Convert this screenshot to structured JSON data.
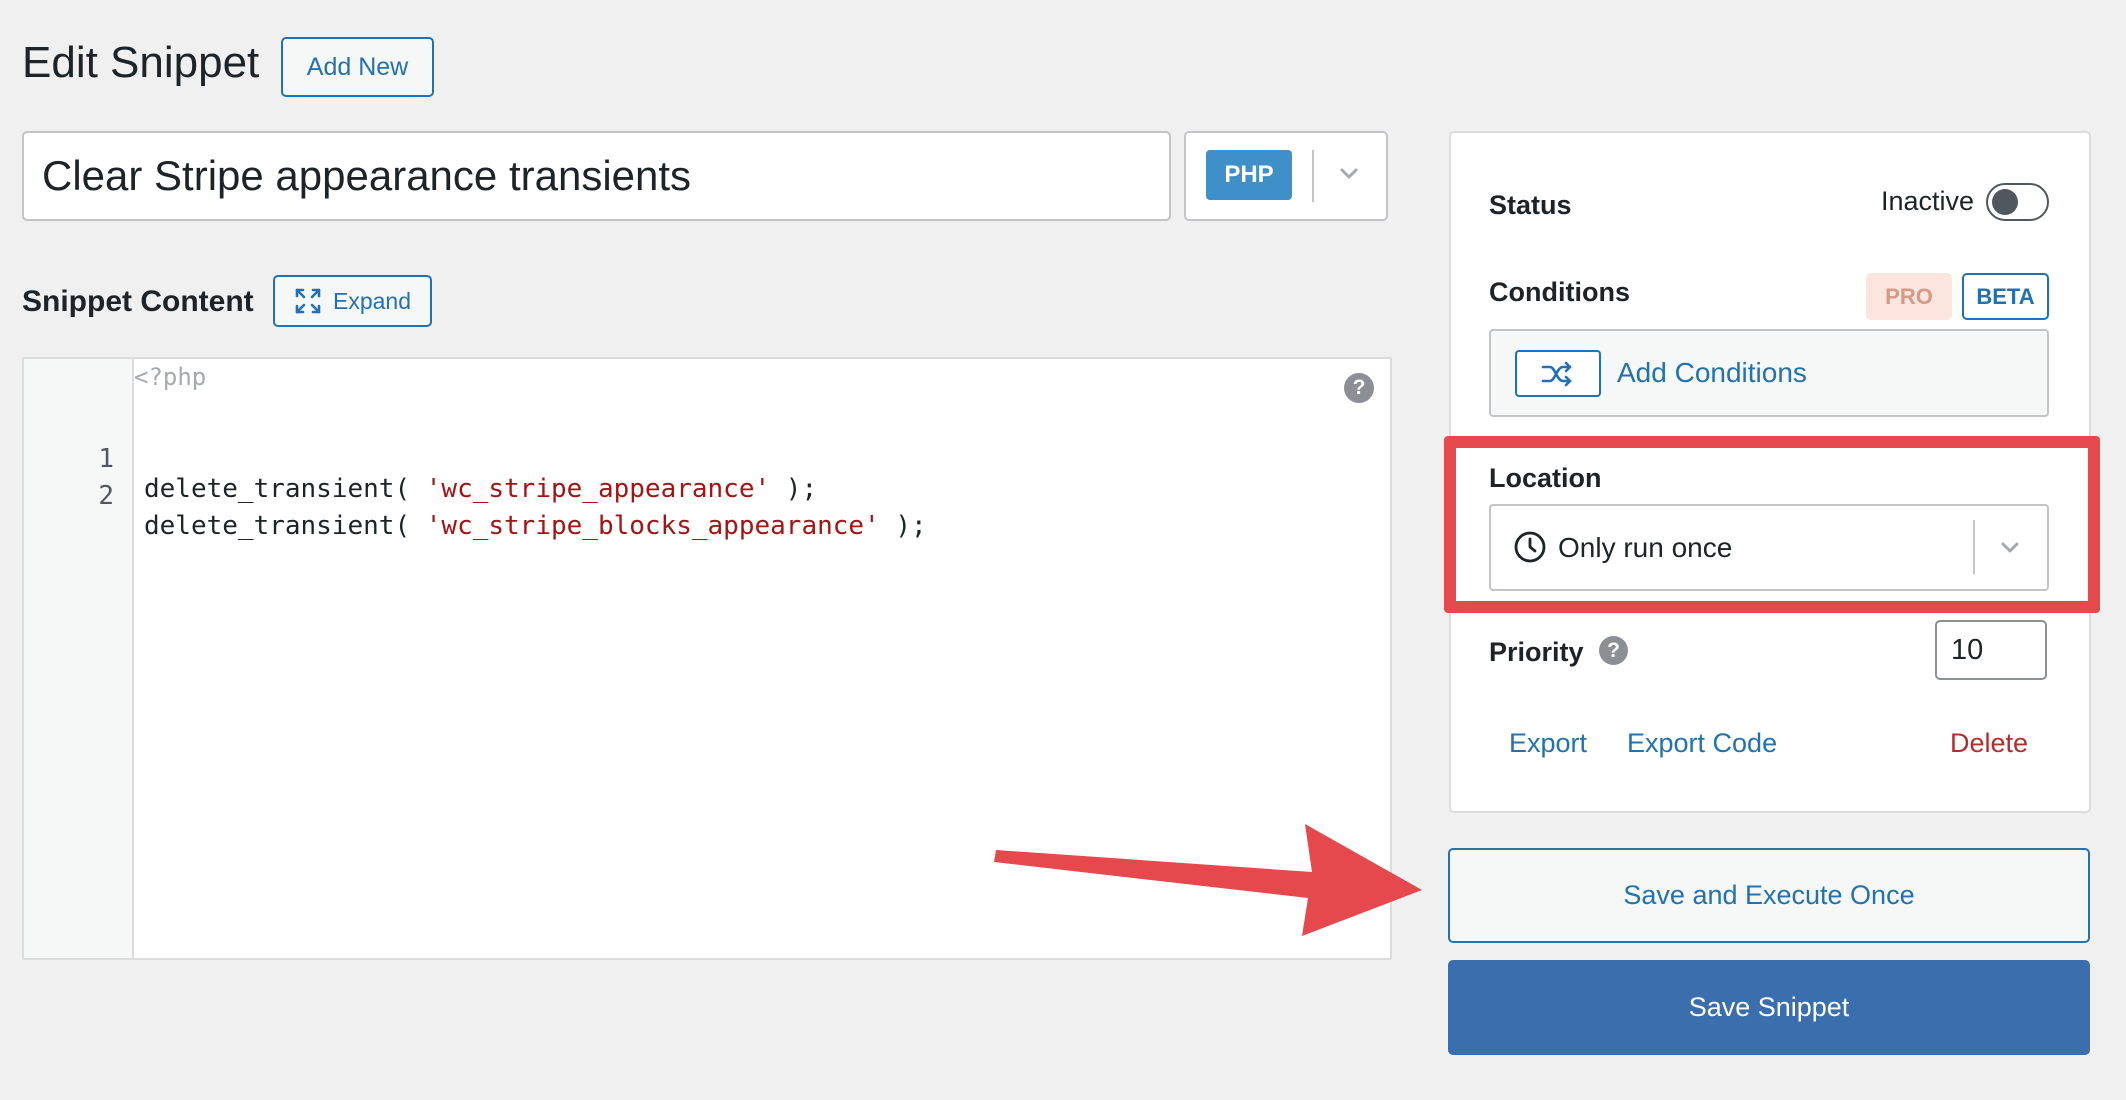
{
  "header": {
    "title": "Edit Snippet",
    "add_new_label": "Add New"
  },
  "snippet": {
    "title_value": "Clear Stripe appearance transients",
    "language": "PHP"
  },
  "content": {
    "section_label": "Snippet Content",
    "expand_label": "Expand",
    "php_open_tag": "<?php",
    "help_symbol": "?",
    "lines": [
      {
        "num": "1",
        "fn": "delete_transient( ",
        "arg": "'wc_stripe_appearance'",
        "end": " );"
      },
      {
        "num": "2",
        "fn": "delete_transient( ",
        "arg": "'wc_stripe_blocks_appearance'",
        "end": " );"
      }
    ]
  },
  "sidebar": {
    "status_label": "Status",
    "status_value": "Inactive",
    "status_active": false,
    "conditions_label": "Conditions",
    "pro_badge": "PRO",
    "beta_badge": "BETA",
    "add_conditions_label": "Add Conditions",
    "location_label": "Location",
    "location_value": "Only run once",
    "priority_label": "Priority",
    "priority_help": "?",
    "priority_value": "10",
    "export_label": "Export",
    "export_code_label": "Export Code",
    "delete_label": "Delete",
    "execute_once_label": "Save and Execute Once",
    "save_label": "Save Snippet"
  },
  "colors": {
    "accent": "#2271b1",
    "primary_button": "#3a6ead",
    "php_badge": "#3f8fc9",
    "annotation_red": "#e5484d",
    "delete_red": "#b32d2e",
    "string_red": "#a31515"
  },
  "icons": {
    "expand": "expand-icon",
    "shuffle": "shuffle-icon",
    "clock": "clock-icon",
    "chevron": "chevron-down-icon",
    "help": "help-icon"
  }
}
